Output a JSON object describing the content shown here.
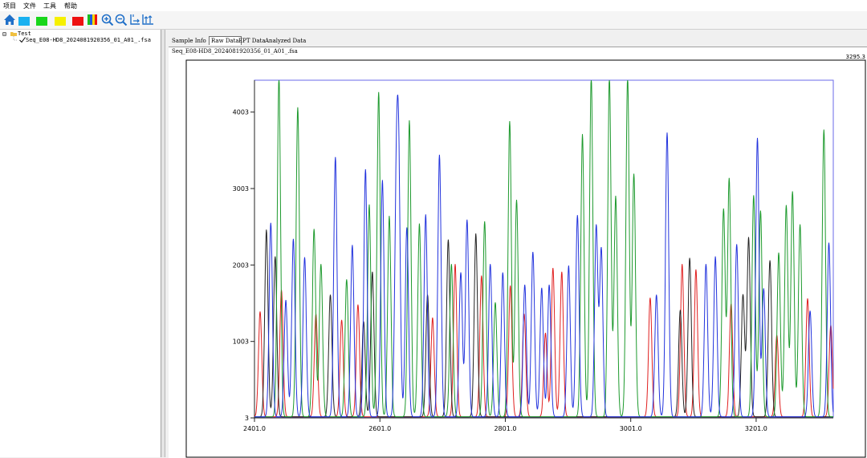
{
  "menu": [
    "项目",
    "文件",
    "工具",
    "帮助"
  ],
  "toolbar": {
    "buttons": [
      {
        "name": "home-button",
        "icon": "home-icon"
      },
      {
        "name": "blue-channel-button",
        "icon": "blue-swatch-icon",
        "color": "#1ab1f0"
      },
      {
        "name": "green-channel-button",
        "icon": "green-swatch-icon",
        "color": "#19d61b"
      },
      {
        "name": "yellow-channel-button",
        "icon": "yellow-swatch-icon",
        "color": "#f6f000"
      },
      {
        "name": "red-channel-button",
        "icon": "red-swatch-icon",
        "color": "#ee1111"
      },
      {
        "name": "all-channels-button",
        "icon": "multicolor-bars-icon"
      },
      {
        "name": "zoom-in-button",
        "icon": "zoom-in-icon"
      },
      {
        "name": "zoom-out-button",
        "icon": "zoom-out-icon"
      },
      {
        "name": "horizontal-scale-button",
        "icon": "horizontal-scale-icon"
      },
      {
        "name": "vertical-scale-button",
        "icon": "vertical-scale-icon"
      }
    ]
  },
  "tree": {
    "expander": "⊟",
    "root": "Test",
    "child": "Seq_E08-HD8_2024081920356_01_A01_.fsa"
  },
  "tabs": [
    {
      "label": "Sample Info",
      "active": false
    },
    {
      "label": "Raw Data",
      "active": true
    },
    {
      "label": "EPT Data",
      "active": false
    },
    {
      "label": "Analyzed Data",
      "active": false
    }
  ],
  "file_label": "Seq_E08-HD8_2024081920356_01_A01_.fsa",
  "max_label": "3295.3",
  "chart_data": {
    "type": "line",
    "x_range": [
      2401,
      3324
    ],
    "ylim": [
      3,
      4420
    ],
    "xticks": [
      2401,
      2601,
      2801,
      3001,
      3201
    ],
    "xtick_labels": [
      "2401.0",
      "2601.0",
      "2801.0",
      "3001.0",
      "3201.0"
    ],
    "yticks": [
      3,
      1003,
      2003,
      3003,
      4003
    ],
    "ytick_labels": [
      "3",
      "1003",
      "2003",
      "3003",
      "4003"
    ],
    "colors": {
      "black": "#222222",
      "red": "#e02020",
      "green": "#1e9a2e",
      "blue": "#2233dd"
    },
    "series": [
      {
        "color_key": "red",
        "peaks": [
          [
            2410,
            1380
          ],
          [
            2444,
            1660
          ],
          [
            2499,
            1350
          ],
          [
            2540,
            1270
          ],
          [
            2566,
            1470
          ],
          [
            2685,
            1300
          ],
          [
            2721,
            2000
          ],
          [
            2763,
            1850
          ],
          [
            2809,
            1720
          ],
          [
            2831,
            1350
          ],
          [
            2865,
            1100
          ],
          [
            2877,
            1950
          ],
          [
            2891,
            1900
          ],
          [
            3032,
            1560
          ],
          [
            3083,
            2000
          ],
          [
            3105,
            1930
          ],
          [
            3161,
            1480
          ],
          [
            3234,
            1070
          ],
          [
            3283,
            1550
          ],
          [
            3320,
            1200
          ]
        ]
      },
      {
        "color_key": "black",
        "peaks": [
          [
            2420,
            2450
          ],
          [
            2434,
            2100
          ],
          [
            2522,
            1600
          ],
          [
            2575,
            1250
          ],
          [
            2589,
            1900
          ],
          [
            2677,
            1600
          ],
          [
            2710,
            2320
          ],
          [
            2754,
            2400
          ],
          [
            3080,
            1400
          ],
          [
            3095,
            2080
          ],
          [
            3180,
            1600
          ],
          [
            3189,
            2350
          ],
          [
            3223,
            2050
          ]
        ]
      },
      {
        "color_key": "green",
        "peaks": [
          [
            2440,
            4450
          ],
          [
            2470,
            4050
          ],
          [
            2496,
            2460
          ],
          [
            2507,
            2000
          ],
          [
            2548,
            1800
          ],
          [
            2584,
            2780
          ],
          [
            2599,
            4250
          ],
          [
            2616,
            2630
          ],
          [
            2648,
            3880
          ],
          [
            2664,
            2530
          ],
          [
            2715,
            2000
          ],
          [
            2768,
            2560
          ],
          [
            2785,
            1500
          ],
          [
            2808,
            3870
          ],
          [
            2819,
            2840
          ],
          [
            2924,
            3700
          ],
          [
            2938,
            4450
          ],
          [
            2967,
            4450
          ],
          [
            2977,
            2890
          ],
          [
            2996,
            4450
          ],
          [
            3006,
            3180
          ],
          [
            3149,
            2720
          ],
          [
            3158,
            3120
          ],
          [
            3197,
            2900
          ],
          [
            3208,
            2700
          ],
          [
            3237,
            2150
          ],
          [
            3249,
            2770
          ],
          [
            3259,
            2950
          ],
          [
            3271,
            2520
          ],
          [
            3309,
            3760
          ]
        ]
      },
      {
        "color_key": "blue",
        "peaks": [
          [
            2427,
            2540
          ],
          [
            2451,
            1530
          ],
          [
            2463,
            2330
          ],
          [
            2481,
            2090
          ],
          [
            2530,
            3400
          ],
          [
            2557,
            2250
          ],
          [
            2578,
            3240
          ],
          [
            2605,
            3100
          ],
          [
            2627,
            2620
          ],
          [
            2631,
            3030
          ],
          [
            2644,
            2480
          ],
          [
            2674,
            2650
          ],
          [
            2696,
            3430
          ],
          [
            2730,
            1890
          ],
          [
            2740,
            2580
          ],
          [
            2777,
            2000
          ],
          [
            2797,
            1890
          ],
          [
            2832,
            1730
          ],
          [
            2845,
            2160
          ],
          [
            2859,
            1690
          ],
          [
            2871,
            1730
          ],
          [
            2902,
            1980
          ],
          [
            2916,
            2640
          ],
          [
            2946,
            2500
          ],
          [
            2954,
            2200
          ],
          [
            3042,
            1600
          ],
          [
            3059,
            3720
          ],
          [
            3121,
            2000
          ],
          [
            3136,
            2100
          ],
          [
            3170,
            2260
          ],
          [
            3203,
            3650
          ],
          [
            3213,
            1680
          ],
          [
            3287,
            1390
          ],
          [
            3317,
            2280
          ]
        ]
      }
    ]
  }
}
